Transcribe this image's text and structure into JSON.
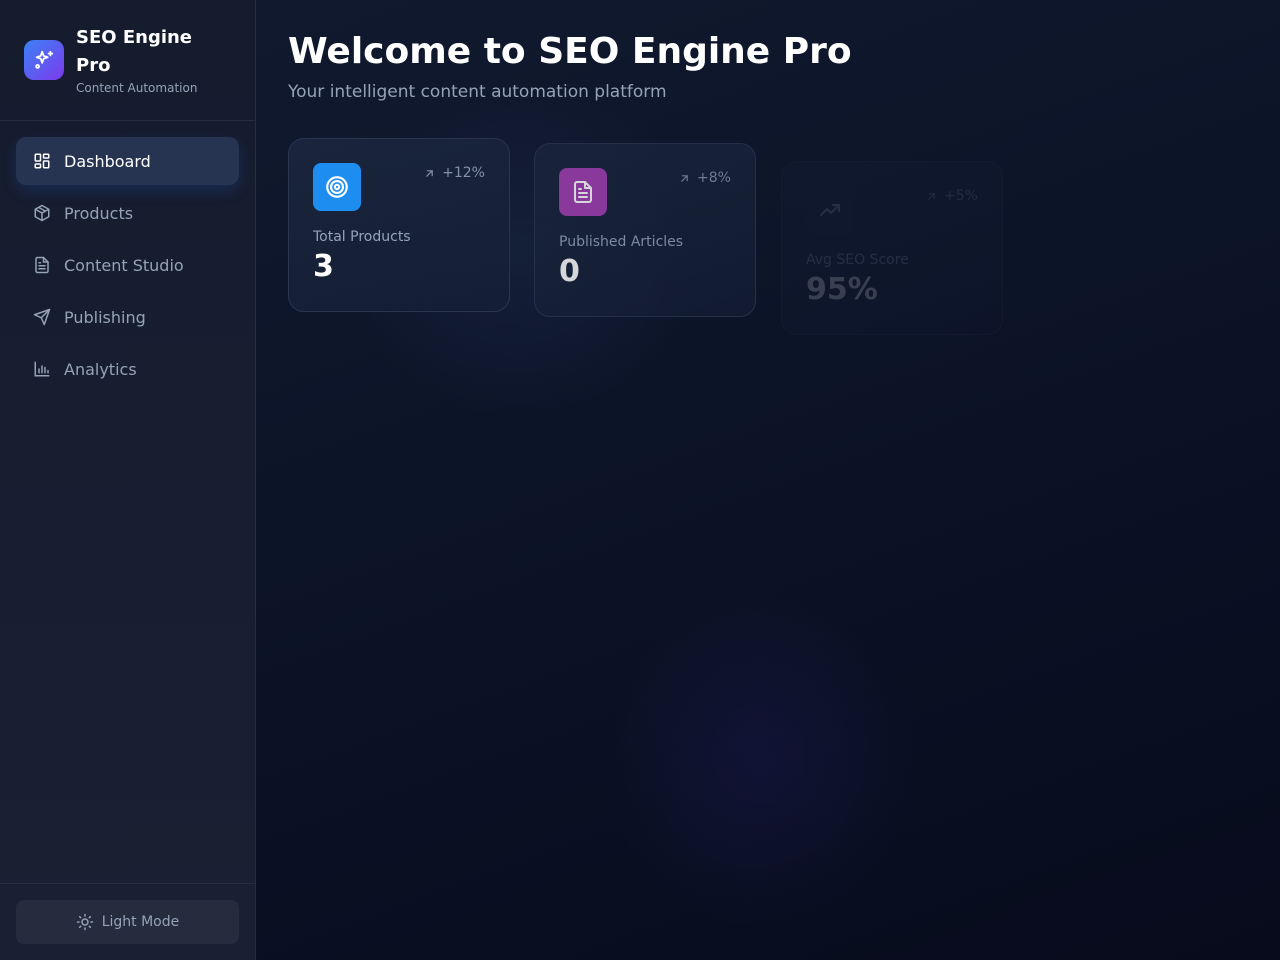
{
  "brand": {
    "title": "SEO Engine Pro",
    "subtitle": "Content Automation",
    "logo_icon": "sparkles-icon"
  },
  "nav": [
    {
      "label": "Dashboard",
      "icon": "layout-grid-icon",
      "active": true
    },
    {
      "label": "Products",
      "icon": "package-icon",
      "active": false
    },
    {
      "label": "Content Studio",
      "icon": "file-text-icon",
      "active": false
    },
    {
      "label": "Publishing",
      "icon": "send-icon",
      "active": false
    },
    {
      "label": "Analytics",
      "icon": "bar-chart-icon",
      "active": false
    }
  ],
  "footer": {
    "theme_label": "Light Mode",
    "theme_icon": "sun-icon"
  },
  "header": {
    "title": "Welcome to SEO Engine Pro",
    "subtitle": "Your intelligent content automation platform"
  },
  "stats": [
    {
      "label": "Total Products",
      "value": "3",
      "trend": "+12%",
      "icon": "target-icon",
      "color": "#1d8ef0"
    },
    {
      "label": "Published Articles",
      "value": "0",
      "trend": "+8%",
      "icon": "file-text-icon",
      "color": "#a43fb3"
    },
    {
      "label": "Avg SEO Score",
      "value": "95%",
      "trend": "+5%",
      "icon": "trending-up-icon",
      "color": "#1e2a40"
    }
  ]
}
